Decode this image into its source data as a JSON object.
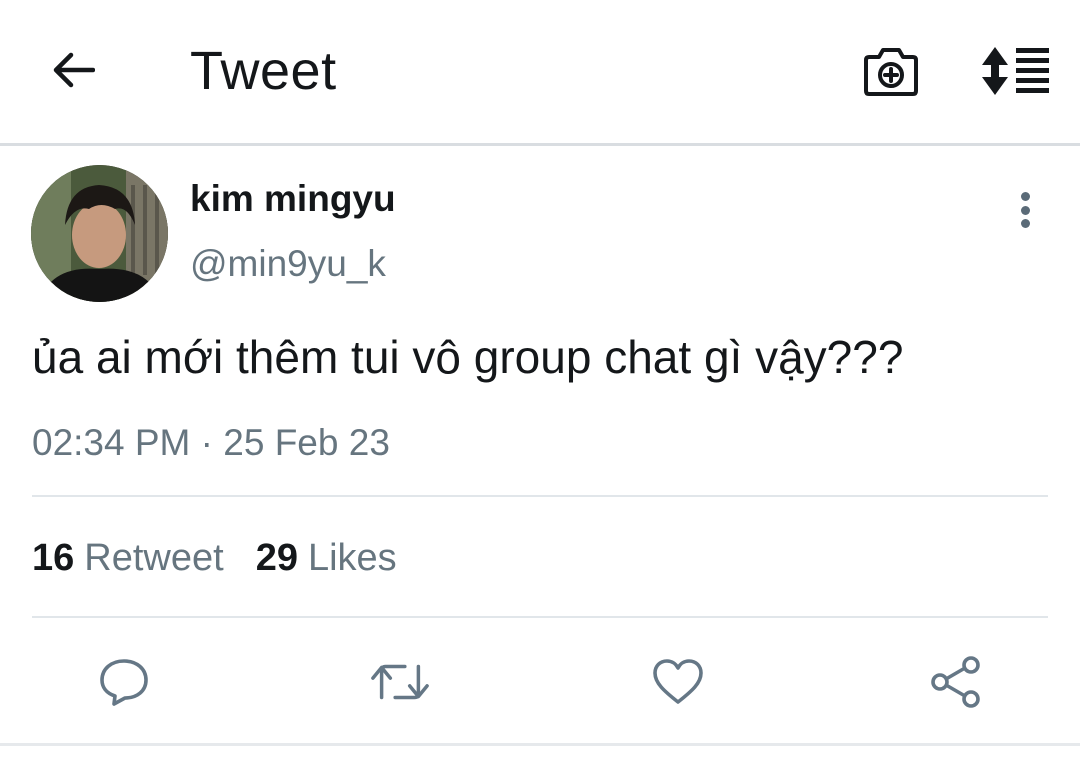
{
  "header": {
    "title": "Tweet",
    "icons": {
      "back": "back-arrow-icon",
      "camera": "camera-add-icon",
      "sort": "sort-list-icon"
    }
  },
  "tweet": {
    "display_name": "kim mingyu",
    "handle": "@min9yu_k",
    "text": "ủa ai mới thêm tui vô group chat gì vậy???",
    "time": "02:34 PM",
    "separator": "·",
    "date": "25 Feb 23"
  },
  "stats": {
    "retweet_count": "16",
    "retweet_label": "Retweet",
    "likes_count": "29",
    "likes_label": "Likes"
  },
  "actions": {
    "reply": "reply-icon",
    "retweet": "retweet-icon",
    "like": "heart-icon",
    "share": "share-icon"
  },
  "colors": {
    "text_primary": "#14171a",
    "text_secondary": "#66757f",
    "icon_blue": "#657786",
    "divider": "#e1e6ea"
  }
}
